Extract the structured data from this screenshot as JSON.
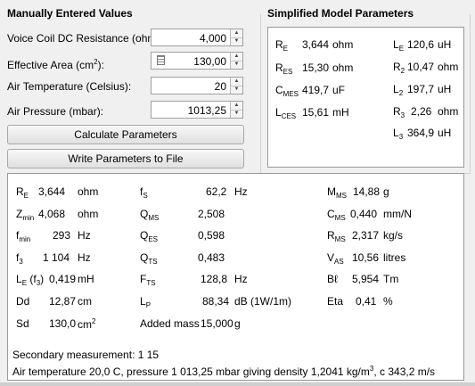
{
  "manual": {
    "title": "Manually Entered Values",
    "voice_coil_label": "Voice Coil DC Resistance (ohm):",
    "voice_coil_value": "4,000",
    "area_label_main": "Effective Area (cm",
    "area_label_sup": "2",
    "area_label_end": "):",
    "area_value": "130,00",
    "air_temp_label": "Air Temperature (Celsius):",
    "air_temp_value": "20",
    "air_pressure_label": "Air Pressure (mbar):",
    "air_pressure_value": "1013,25",
    "calc_button": "Calculate Parameters",
    "write_button": "Write Parameters to File"
  },
  "model": {
    "title": "Simplified Model Parameters",
    "re_sym": "R",
    "re_sub": "E",
    "re_val": "3,644",
    "re_unit": "ohm",
    "res_sym": "R",
    "res_sub": "ES",
    "res_val": "15,30",
    "res_unit": "ohm",
    "cmes_sym": "C",
    "cmes_sub": "MES",
    "cmes_val": "419,7",
    "cmes_unit": "uF",
    "lces_sym": "L",
    "lces_sub": "CES",
    "lces_val": "15,61",
    "lces_unit": "mH",
    "le_sym": "L",
    "le_sub": "E",
    "le_val": "120,6",
    "le_unit": "uH",
    "r2_sym": "R",
    "r2_sub": "2",
    "r2_val": "10,47",
    "r2_unit": "ohm",
    "l2_sym": "L",
    "l2_sub": "2",
    "l2_val": "197,7",
    "l2_unit": "uH",
    "r3_sym": "R",
    "r3_sub": "3",
    "r3_val": "2,26",
    "r3_unit": "ohm",
    "l3_sym": "L",
    "l3_sub": "3",
    "l3_val": "364,9",
    "l3_unit": "uH"
  },
  "results": {
    "re": {
      "sym": "R",
      "sub": "E",
      "val": "3,644",
      "unit": "ohm"
    },
    "zmin": {
      "sym": "Z",
      "sub": "min",
      "val": "4,068",
      "unit": "ohm"
    },
    "fmin": {
      "sym": "f",
      "sub": "min",
      "val": "293",
      "unit": "Hz"
    },
    "f3": {
      "sym": "f",
      "sub": "3",
      "val": "1 104",
      "unit": "Hz"
    },
    "lef3": {
      "sym": "L",
      "sub": "E",
      "mid": " (f",
      "sub2": "3",
      "end": ")",
      "val": "0,419",
      "unit": "mH"
    },
    "dd": {
      "sym": "Dd",
      "val": "12,87",
      "unit": "cm"
    },
    "sd": {
      "sym": "Sd",
      "val": "130,0",
      "unit": "cm",
      "unit_sup": "2"
    },
    "fs": {
      "sym": "f",
      "sub": "S",
      "val": "62,2",
      "unit": "Hz"
    },
    "qms": {
      "sym": "Q",
      "sub": "MS",
      "val": "2,508"
    },
    "qes": {
      "sym": "Q",
      "sub": "ES",
      "val": "0,598"
    },
    "qts": {
      "sym": "Q",
      "sub": "TS",
      "val": "0,483"
    },
    "fts": {
      "sym": "F",
      "sub": "TS",
      "val": "128,8",
      "unit": "Hz"
    },
    "lp": {
      "sym": "L",
      "sub": "P",
      "val": "88,34",
      "unit": "dB (1W/1m)"
    },
    "added_mass": {
      "label": "Added mass",
      "val": "15,000",
      "unit": "g"
    },
    "mms": {
      "sym": "M",
      "sub": "MS",
      "val": "14,88",
      "unit": "g"
    },
    "cms": {
      "sym": "C",
      "sub": "MS",
      "val": "0,440",
      "unit": "mm/N"
    },
    "rms": {
      "sym": "R",
      "sub": "MS",
      "val": "2,317",
      "unit": "kg/s"
    },
    "vas": {
      "sym": "V",
      "sub": "AS",
      "val": "10,56",
      "unit": "litres"
    },
    "bl": {
      "sym": "Bℓ",
      "val": "5,954",
      "unit": "Tm"
    },
    "eta": {
      "sym": "Eta",
      "val": "0,41",
      "unit": "%"
    },
    "secondary": "Secondary measurement: 1 15",
    "air_line_a": "Air temperature 20,0 C, pressure 1 013,25 mbar giving density 1,2041 kg/m",
    "air_line_sup": "3",
    "air_line_b": ", c 343,2 m/s"
  }
}
